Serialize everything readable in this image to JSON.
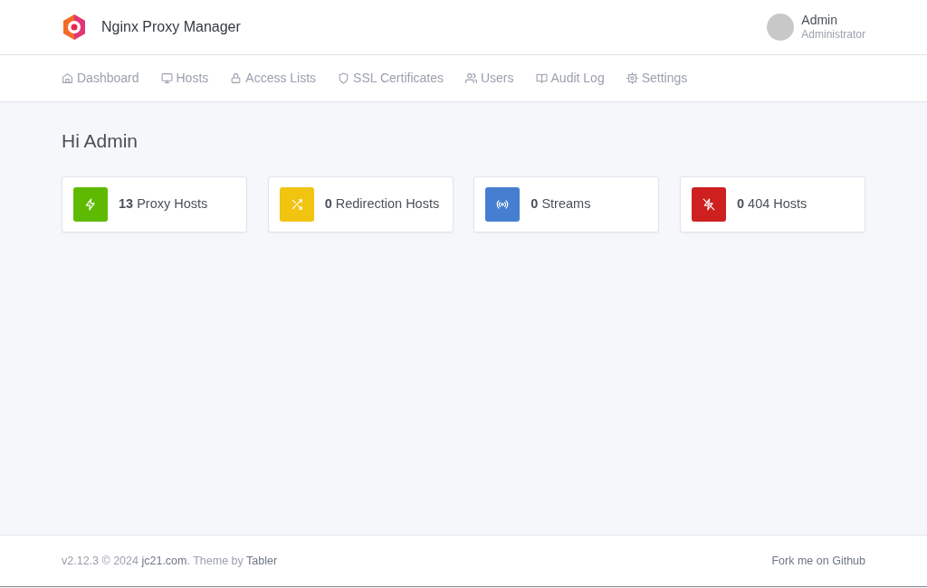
{
  "header": {
    "brand": "Nginx Proxy Manager",
    "user": {
      "name": "Admin",
      "role": "Administrator"
    }
  },
  "nav": [
    {
      "label": "Dashboard",
      "selected": false
    },
    {
      "label": "Hosts",
      "selected": false
    },
    {
      "label": "Access Lists",
      "selected": false
    },
    {
      "label": "SSL Certificates",
      "selected": false
    },
    {
      "label": "Users",
      "selected": false
    },
    {
      "label": "Audit Log",
      "selected": false
    },
    {
      "label": "Settings",
      "selected": false
    }
  ],
  "page_title": "Hi Admin",
  "stats": [
    {
      "count": "13",
      "label": "Proxy Hosts",
      "color": "#5eba00"
    },
    {
      "count": "0",
      "label": "Redirection Hosts",
      "color": "#f1c40f"
    },
    {
      "count": "0",
      "label": "Streams",
      "color": "#467fcf"
    },
    {
      "count": "0",
      "label": "404 Hosts",
      "color": "#cd201f"
    }
  ],
  "footer": {
    "credit": [
      {
        "kind": "text",
        "text": "v2.12.3 © 2024 "
      },
      {
        "kind": "link",
        "text": "jc21.com"
      },
      {
        "kind": "text",
        "text": ". Theme by "
      },
      {
        "kind": "link",
        "text": "Tabler"
      }
    ],
    "link": "Fork me on Github"
  }
}
